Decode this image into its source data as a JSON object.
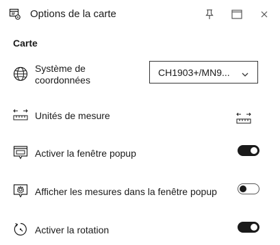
{
  "window": {
    "title": "Options de la carte",
    "title_icon": "map-options-icon",
    "pin_icon": "pin-icon",
    "restore_icon": "restore-icon",
    "close_icon": "close-icon"
  },
  "section": {
    "heading": "Carte"
  },
  "settings": {
    "coordinate_system": {
      "icon": "globe-icon",
      "label_line1": "Système de",
      "label_line2": "coordonnées",
      "selected_value": "CH1903+/MN9...",
      "chevron_icon": "chevron-down-icon"
    },
    "measure_units": {
      "icon": "ruler-icon",
      "label": "Unités de mesure",
      "button_icon": "ruler-icon"
    },
    "popup": {
      "icon": "popup-window-icon",
      "label": "Activer la fenêtre popup",
      "enabled": true
    },
    "popup_measurements": {
      "icon": "measure-settings-icon",
      "label": "Afficher les mesures dans la fenêtre popup",
      "enabled": false
    },
    "rotation": {
      "icon": "rotation-icon",
      "label": "Activer la rotation",
      "enabled": true
    }
  }
}
